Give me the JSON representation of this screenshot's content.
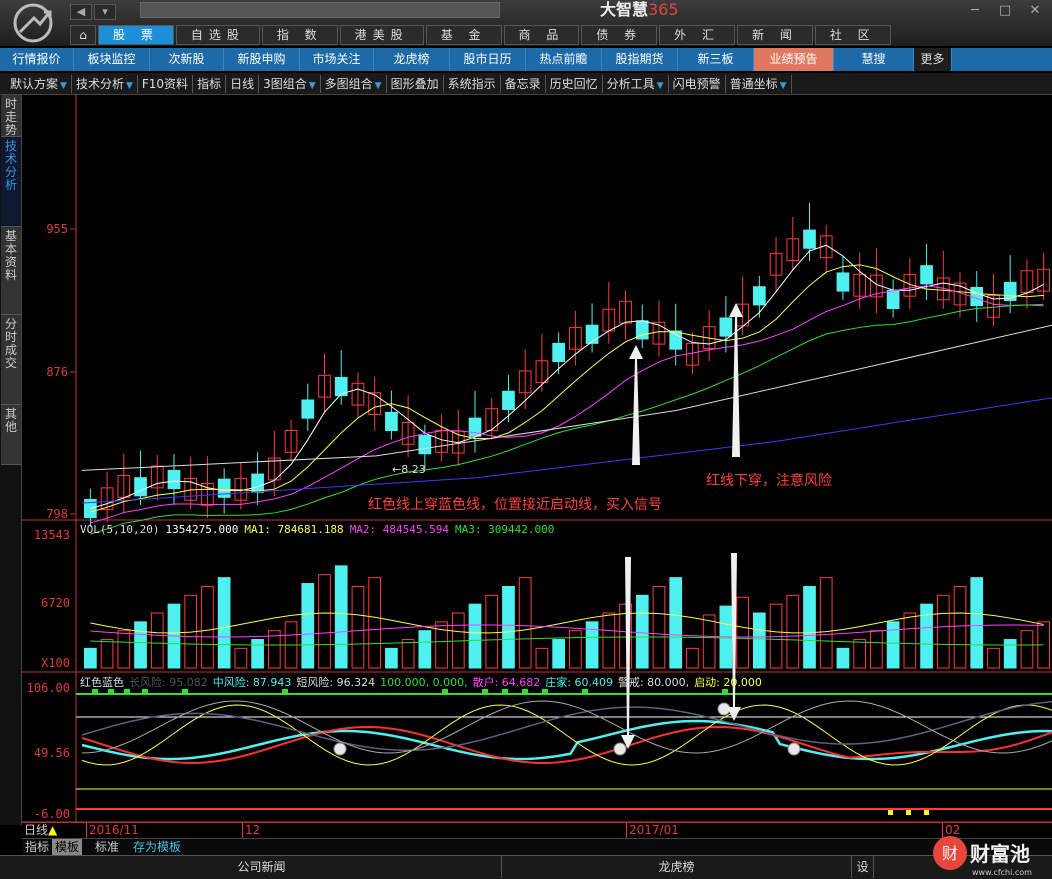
{
  "window": {
    "brand_text": "大智慧",
    "brand_num": "365",
    "min": "─",
    "max": "□",
    "close": "✕"
  },
  "main_tabs": [
    {
      "label": "股 票",
      "active": true
    },
    {
      "label": "自选股"
    },
    {
      "label": "指 数"
    },
    {
      "label": "港美股"
    },
    {
      "label": "基 金"
    },
    {
      "label": "商 品"
    },
    {
      "label": "债 券"
    },
    {
      "label": "外 汇"
    },
    {
      "label": "新 闻"
    },
    {
      "label": "社 区"
    }
  ],
  "sub_nav": [
    "行情报价",
    "板块监控",
    "次新股",
    "新股申购",
    "市场关注",
    "龙虎榜",
    "股市日历",
    "热点前瞻",
    "股指期货",
    "新三板",
    "业绩预告",
    "慧搜",
    "更多"
  ],
  "toolbar": [
    "默认方案",
    "技术分析",
    "F10资料",
    "指标",
    "日线",
    "3图组合",
    "多图组合",
    "图形叠加",
    "系统指示",
    "备忘录",
    "历史回忆",
    "分析工具",
    "闪电预警",
    "普通坐标"
  ],
  "left_tabs": [
    "时走势",
    "技术分析",
    "基本资料",
    "分时成交",
    "其他"
  ],
  "price_axis": {
    "top": "955",
    "mid": "876",
    "bottom": "798"
  },
  "vol_axis": {
    "top": "13543",
    "mid": "6720",
    "unit": "X100"
  },
  "ind_axis": {
    "top": "106.00",
    "mid": "49.56",
    "bottom": "-6.00"
  },
  "vol_legend": {
    "name": "VOL(5,10,20)",
    "v": "1354275.000",
    "ma1": "MA1: 784681.188",
    "ma2": "MA2: 484545.594",
    "ma3": "MA3: 309442.000"
  },
  "ind_legend": {
    "name": "红色蓝色",
    "a": "长风险: 95.082",
    "b": "中风险: 87.943",
    "c": "短风险: 96.324",
    "d": "100.000, 0.000,",
    "e": "散户: 64.682",
    "f": "庄家: 60.409",
    "g": "警戒: 80.000,",
    "h": "启动: 20.000"
  },
  "annotations": {
    "low": "←8.23",
    "buy": "红色线上穿蓝色线，位置接近启动线，买入信号",
    "sell": "红线下穿，注意风险"
  },
  "date_axis": {
    "period": "日线",
    "d1": "2016/11",
    "d2": "12",
    "d3": "2017/01",
    "d4": "02"
  },
  "bottom_tabs": [
    "指标",
    "模板",
    "标准",
    "存为模板"
  ],
  "bottom_bar": [
    "公司新闻",
    "龙虎榜",
    "设"
  ],
  "watermark": {
    "text": "财富池",
    "url": "www.cfchi.com"
  },
  "colors": {
    "up": "#ff3b3b",
    "down": "#4ef0f0",
    "accent": "#1d8fd8"
  }
}
